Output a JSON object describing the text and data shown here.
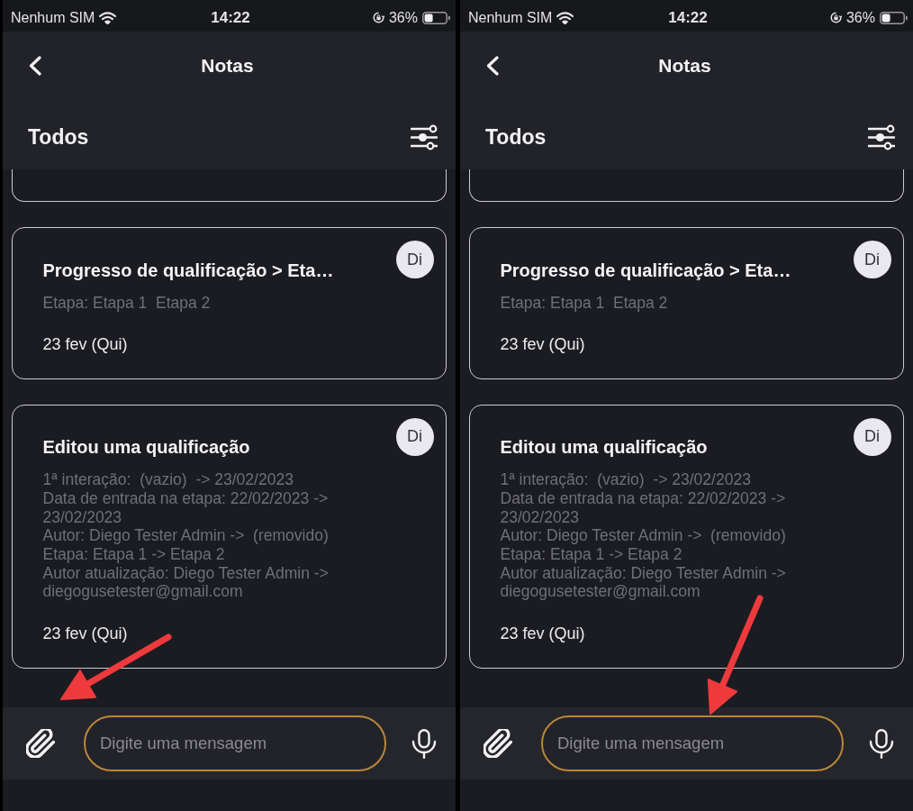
{
  "screens": [
    {
      "status_bar": {
        "carrier": "Nenhum SIM",
        "time": "14:22",
        "battery": "36%"
      },
      "header": {
        "title": "Notas",
        "filter": "Todos"
      },
      "notes": [
        {
          "kind": "clipped"
        },
        {
          "kind": "note",
          "title": "Progresso de qualificação > Eta…",
          "author": "Di",
          "details": [
            "Etapa: Etapa 1  Etapa 2"
          ],
          "date": "23 fev (Qui)"
        },
        {
          "kind": "note",
          "title": "Editou uma qualificação",
          "author": "Di",
          "details": [
            "1ª interação:  (vazio)  -> 23/02/2023",
            "Data de entrada na etapa: 22/02/2023 -> 23/02/2023",
            "Autor: Diego Tester Admin ->  (removido)",
            "Etapa: Etapa 1 -> Etapa 2",
            "Autor atualização: Diego Tester Admin -> diegogusetester@gmail.com"
          ],
          "date": "23 fev (Qui)"
        }
      ],
      "composer": {
        "placeholder": "Digite uma mensagem",
        "attach_arrow": true,
        "input_arrow": false
      }
    },
    {
      "status_bar": {
        "carrier": "Nenhum SIM",
        "time": "14:22",
        "battery": "36%"
      },
      "header": {
        "title": "Notas",
        "filter": "Todos"
      },
      "notes": [
        {
          "kind": "clipped"
        },
        {
          "kind": "note",
          "title": "Progresso de qualificação > Eta…",
          "author": "Di",
          "details": [
            "Etapa: Etapa 1  Etapa 2"
          ],
          "date": "23 fev (Qui)"
        },
        {
          "kind": "note",
          "title": "Editou uma qualificação",
          "author": "Di",
          "details": [
            "1ª interação:  (vazio)  -> 23/02/2023",
            "Data de entrada na etapa: 22/02/2023 -> 23/02/2023",
            "Autor: Diego Tester Admin ->  (removido)",
            "Etapa: Etapa 1 -> Etapa 2",
            "Autor atualização: Diego Tester Admin -> diegogusetester@gmail.com"
          ],
          "date": "23 fev (Qui)"
        }
      ],
      "composer": {
        "placeholder": "Digite uma mensagem",
        "attach_arrow": false,
        "input_arrow": true
      }
    }
  ]
}
